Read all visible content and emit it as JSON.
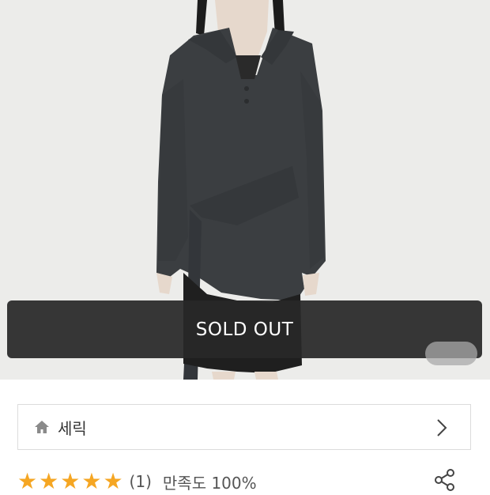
{
  "overlay": {
    "sold_out_label": "SOLD OUT"
  },
  "brand": {
    "name": "세릭"
  },
  "rating": {
    "stars": 5,
    "review_count_text": "(1)",
    "satisfaction_text": "만족도 100%"
  },
  "colors": {
    "star": "#f5a623",
    "sold_out_bg": "#282828",
    "photo_bg": "#ececea",
    "garment": "#3b3e41"
  },
  "icons": {
    "home": "home-icon",
    "chevron": "chevron-right-icon",
    "share": "share-icon",
    "star": "star-icon"
  }
}
